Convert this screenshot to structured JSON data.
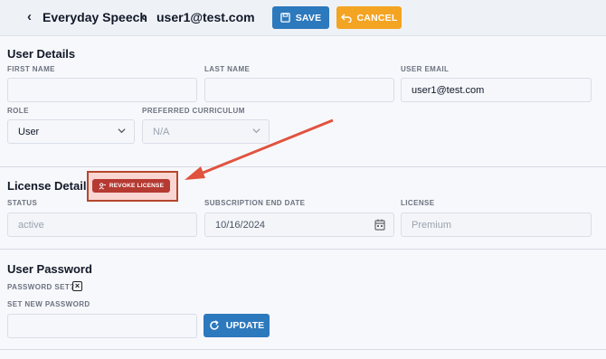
{
  "header": {
    "breadcrumb": [
      {
        "label": "Everyday Speech"
      },
      {
        "label": "user1@test.com"
      }
    ],
    "save_label": "SAVE",
    "cancel_label": "CANCEL"
  },
  "user_details": {
    "title": "User Details",
    "first_name": {
      "label": "FIRST NAME",
      "value": ""
    },
    "last_name": {
      "label": "LAST NAME",
      "value": ""
    },
    "email": {
      "label": "USER EMAIL",
      "value": "user1@test.com"
    },
    "role": {
      "label": "ROLE",
      "value": "User"
    },
    "curriculum": {
      "label": "PREFERRED CURRICULUM",
      "value": "N/A"
    }
  },
  "license_details": {
    "title": "License Details",
    "revoke_label": "REVOKE LICENSE",
    "status": {
      "label": "STATUS",
      "value": "active"
    },
    "subscription_end": {
      "label": "SUBSCRIPTION END DATE",
      "value": "10/16/2024"
    },
    "license": {
      "label": "LICENSE",
      "value": "Premium"
    }
  },
  "user_password": {
    "title": "User Password",
    "password_set_label": "PASSWORD SET?",
    "password_set_mark": "×",
    "new_password_label": "SET NEW PASSWORD",
    "new_password_value": "",
    "update_label": "UPDATE"
  },
  "colors": {
    "primary": "#2d79bd",
    "cancel": "#f4a423",
    "revoke": "#b53a32",
    "annotation": "#e0533f"
  },
  "icons": {
    "back": "chevron-left-icon",
    "save": "floppy-disk-icon",
    "cancel": "undo-arrow-icon",
    "revoke": "user-remove-icon",
    "calendar": "calendar-icon",
    "update": "refresh-icon",
    "select": "chevron-down-icon"
  }
}
